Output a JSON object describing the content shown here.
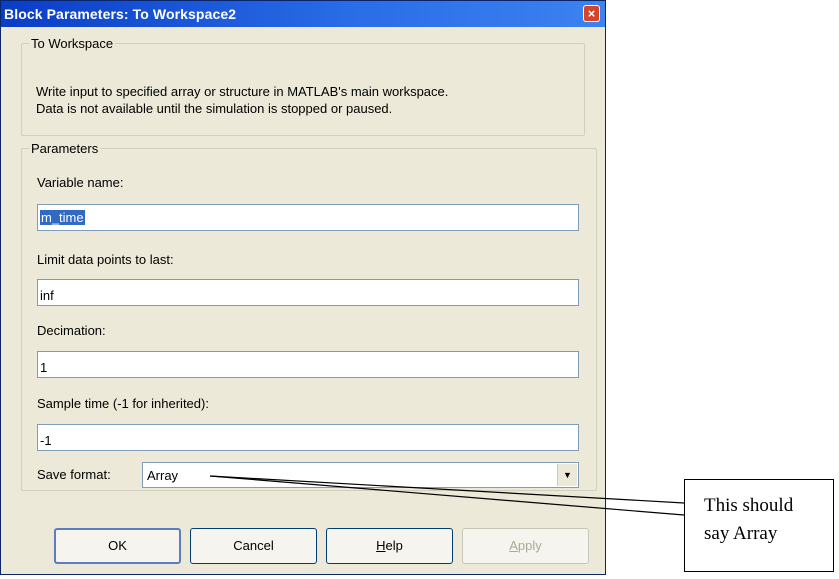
{
  "window": {
    "title": "Block Parameters: To Workspace2",
    "close_glyph": "×",
    "accent_color": "#0a3dc6"
  },
  "block_group": {
    "legend": "To Workspace",
    "description": [
      "Write input to specified array or structure in MATLAB's main workspace.",
      "Data is not available until the simulation is stopped or paused."
    ]
  },
  "parameters": {
    "legend": "Parameters",
    "variable_name": {
      "label": "Variable name:",
      "value": "m_time"
    },
    "limit_data_points": {
      "label": "Limit data points to last:",
      "value": "inf"
    },
    "decimation": {
      "label": "Decimation:",
      "value": "1"
    },
    "sample_time": {
      "label": "Sample time (-1 for inherited):",
      "value": "-1"
    },
    "save_format": {
      "label": "Save format:",
      "value": "Array",
      "arrow_glyph": "▼"
    }
  },
  "buttons": {
    "ok": "OK",
    "cancel": "Cancel",
    "help": {
      "pre": "",
      "mnemonic": "H",
      "post": "elp"
    },
    "apply": {
      "pre": "",
      "mnemonic": "A",
      "post": "pply"
    }
  },
  "annotation": {
    "lines": [
      "This should",
      "say Array"
    ]
  }
}
